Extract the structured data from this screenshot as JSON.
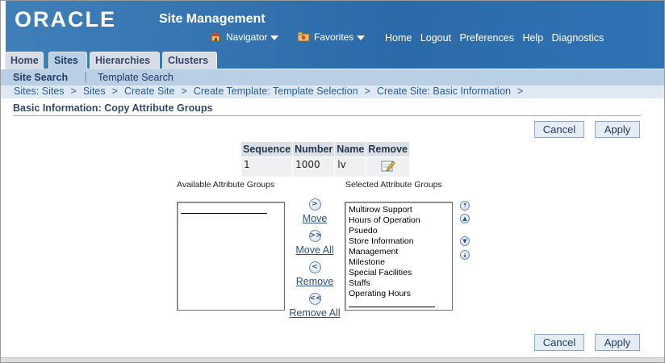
{
  "header": {
    "logo_text": "ORACLE",
    "app_title": "Site Management",
    "navigator_label": "Navigator",
    "favorites_label": "Favorites",
    "links": [
      "Home",
      "Logout",
      "Preferences",
      "Help",
      "Diagnostics"
    ]
  },
  "tabs": [
    {
      "label": "Home",
      "active": false
    },
    {
      "label": "Sites",
      "active": true
    },
    {
      "label": "Hierarchies",
      "active": false
    },
    {
      "label": "Clusters",
      "active": false
    }
  ],
  "subtabs": {
    "site_search": "Site Search",
    "separator": "|",
    "template_search": "Template Search"
  },
  "breadcrumb": {
    "items": [
      "Sites: Sites",
      "Sites",
      "Create Site",
      "Create Template: Template Selection",
      "Create Site: Basic Information"
    ],
    "separator": ">"
  },
  "page_title": "Basic Information: Copy Attribute Groups",
  "buttons": {
    "cancel": "Cancel",
    "apply": "Apply"
  },
  "table": {
    "headers": [
      "Sequence",
      "Number",
      "Name",
      "Remove"
    ],
    "rows": [
      {
        "sequence": "1",
        "number": "1000",
        "name": "lv"
      }
    ]
  },
  "shuttle": {
    "available_header": "Available Attribute Groups",
    "selected_header": "Selected Attribute Groups",
    "move": "Move",
    "move_all": "Move All",
    "remove": "Remove",
    "remove_all": "Remove All",
    "available_items": [],
    "selected_items": [
      "Multirow Support",
      "Hours of Operation",
      "Psuedo",
      "Store Information",
      "Management",
      "Milestone",
      "Special Facilities",
      "Staffs",
      "Operating Hours"
    ]
  },
  "colors": {
    "header_blue": "#2b6aa8",
    "subtab_blue": "#b8cfe6",
    "crumb_bg": "#dfe9f3",
    "link_blue": "#2a5d93"
  }
}
